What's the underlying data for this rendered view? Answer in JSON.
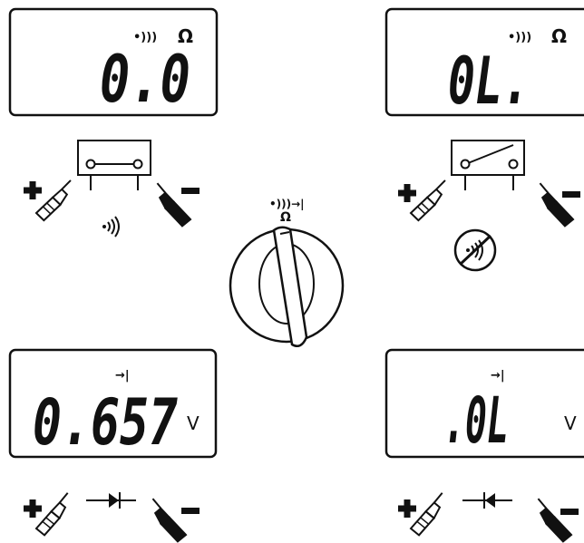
{
  "panels": {
    "continuity_closed": {
      "reading": "0.0",
      "beep_symbol": "•)))",
      "unit": "Ω"
    },
    "continuity_open": {
      "reading": "0L.",
      "beep_symbol": "•)))",
      "unit": "Ω"
    },
    "diode_forward": {
      "reading": "0.657",
      "diode_symbol": "→|",
      "unit": "V"
    },
    "diode_reverse": {
      "reading": ".0L",
      "diode_symbol": "→|",
      "unit": "V"
    }
  },
  "dial": {
    "mode_symbol": "•)))→|",
    "ohm_symbol": "Ω"
  },
  "probes": {
    "positive_label": "+",
    "negative_label": "−"
  },
  "icons": {
    "beep": "beep-icon",
    "no_beep": "no-beep-icon",
    "switch_closed": "closed-switch-icon",
    "switch_open": "open-switch-icon",
    "diode": "diode-icon",
    "rotary_dial": "rotary-dial-icon"
  }
}
